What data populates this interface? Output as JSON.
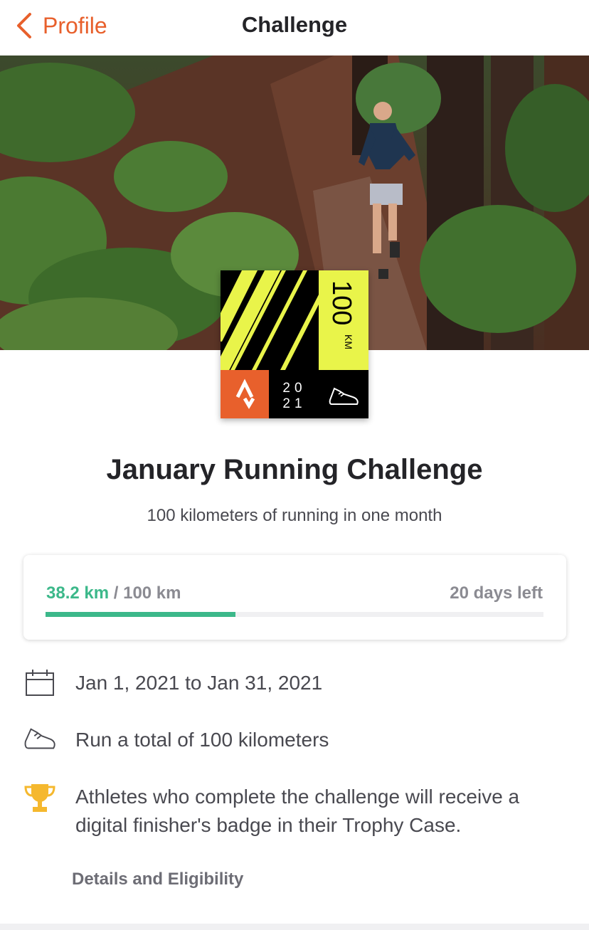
{
  "header": {
    "back_label": "Profile",
    "title": "Challenge"
  },
  "badge": {
    "distance": "100",
    "unit": "KM",
    "year_top": "20",
    "year_bottom": "21"
  },
  "challenge": {
    "title": "January Running Challenge",
    "subtitle": "100 kilometers of running in one month"
  },
  "progress": {
    "current": "38.2 km",
    "separator": " / ",
    "goal": "100 km",
    "days_left": "20 days left",
    "fraction": 0.382
  },
  "info": {
    "dates": "Jan 1, 2021 to Jan 31, 2021",
    "goal": "Run a total of 100 kilometers",
    "reward": "Athletes who complete the challenge will receive a digital finisher's badge in their Trophy Case."
  },
  "details_link": "Details and Eligibility",
  "colors": {
    "accent": "#e8602c",
    "progress": "#3cb88a",
    "badge_yellow": "#e9f44a",
    "trophy": "#f5b82e"
  },
  "icons": [
    "chevron-left-icon",
    "calendar-icon",
    "shoe-icon",
    "trophy-icon",
    "strava-logo"
  ]
}
